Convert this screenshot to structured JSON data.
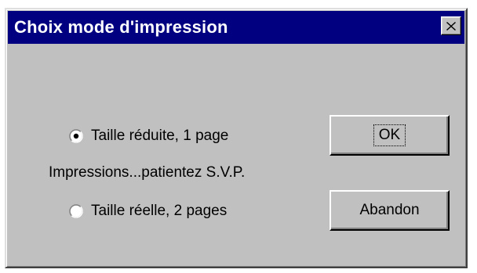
{
  "window": {
    "title": "Choix mode d'impression",
    "close_icon": "close-icon"
  },
  "options": [
    {
      "label": "Taille réduite, 1 page",
      "selected": true
    },
    {
      "label": "Taille réelle, 2 pages",
      "selected": false
    }
  ],
  "status_text": "Impressions...patientez S.V.P.",
  "buttons": {
    "ok_label": "OK",
    "cancel_label": "Abandon"
  },
  "colors": {
    "titlebar": "#000080",
    "face": "#c0c0c0"
  }
}
